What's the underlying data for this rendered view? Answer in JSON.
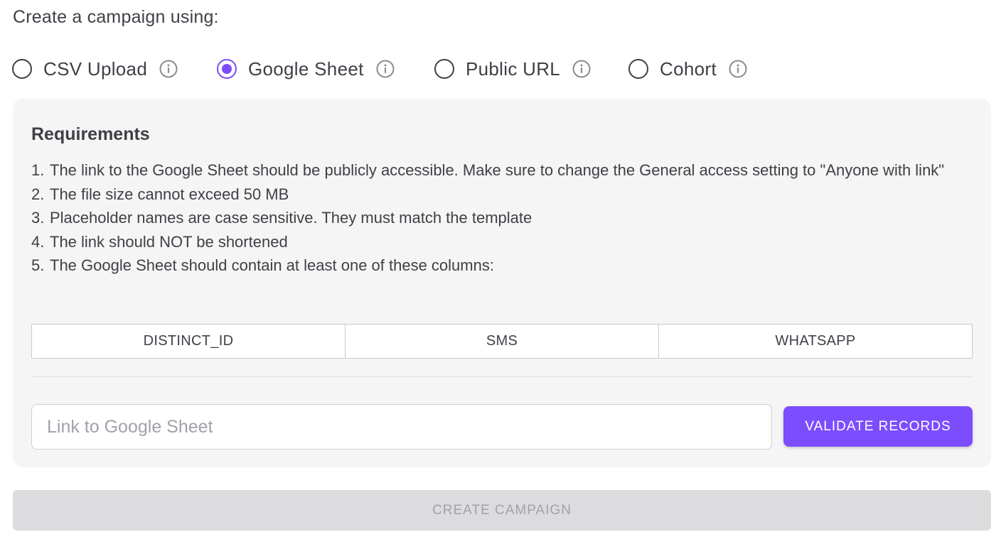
{
  "header": {
    "title": "Create a campaign using:"
  },
  "source_options": [
    {
      "label": "CSV Upload",
      "selected": false,
      "icon": "info-icon"
    },
    {
      "label": "Google Sheet",
      "selected": true,
      "icon": "info-icon"
    },
    {
      "label": "Public URL",
      "selected": false,
      "icon": "info-icon"
    },
    {
      "label": "Cohort",
      "selected": false,
      "icon": "info-icon"
    }
  ],
  "requirements": {
    "title": "Requirements",
    "items": [
      {
        "num": "1.",
        "text": "The link to the Google Sheet should be publicly accessible. Make sure to change the General access setting to \"Anyone with link\""
      },
      {
        "num": "2.",
        "text": "The file size cannot exceed 50 MB"
      },
      {
        "num": "3.",
        "text": "Placeholder names are case sensitive. They must match the template"
      },
      {
        "num": "4.",
        "text": "The link should NOT be shortened"
      },
      {
        "num": "5.",
        "text": "The Google Sheet should contain at least one of these columns:"
      }
    ],
    "columns": [
      "DISTINCT_ID",
      "SMS",
      "WHATSAPP"
    ]
  },
  "link_input": {
    "value": "",
    "placeholder": "Link to Google Sheet"
  },
  "validate_button": {
    "label": "VALIDATE RECORDS"
  },
  "create_button": {
    "label": "CREATE CAMPAIGN",
    "disabled": true
  },
  "colors": {
    "accent": "#7c4dff",
    "panel_bg": "#f5f5f5",
    "text": "#3f3f46",
    "disabled_bg": "#dcdcde",
    "disabled_text": "#a1a1aa"
  }
}
